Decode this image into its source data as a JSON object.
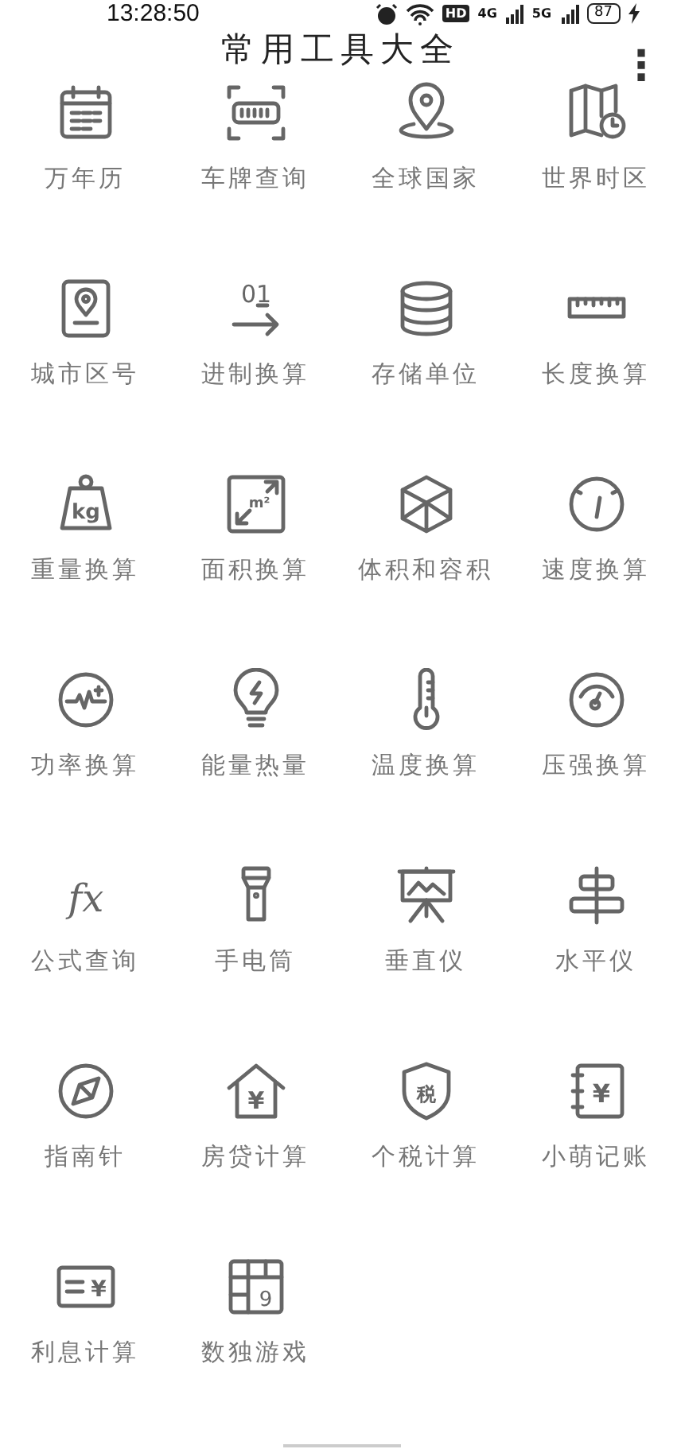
{
  "status_bar": {
    "time": "13:28:50",
    "hd": "HD",
    "net1": "4G",
    "net2": "5G",
    "battery": "87"
  },
  "header": {
    "title": "常用工具大全",
    "menu": "⋮"
  },
  "tools": [
    {
      "label": "万年历",
      "kind": "calendar"
    },
    {
      "label": "车牌查询",
      "kind": "plate"
    },
    {
      "label": "全球国家",
      "kind": "pin"
    },
    {
      "label": "世界时区",
      "kind": "mapclock"
    },
    {
      "label": "城市区号",
      "kind": "citypin"
    },
    {
      "label": "进制换算",
      "kind": "binary",
      "glyph": "01"
    },
    {
      "label": "存储单位",
      "kind": "database"
    },
    {
      "label": "长度换算",
      "kind": "ruler"
    },
    {
      "label": "重量换算",
      "kind": "weight",
      "glyph": "kg"
    },
    {
      "label": "面积换算",
      "kind": "area",
      "glyph": "m²"
    },
    {
      "label": "体积和容积",
      "kind": "cube"
    },
    {
      "label": "速度换算",
      "kind": "speed"
    },
    {
      "label": "功率换算",
      "kind": "power"
    },
    {
      "label": "能量热量",
      "kind": "bulb"
    },
    {
      "label": "温度换算",
      "kind": "thermo"
    },
    {
      "label": "压强换算",
      "kind": "gauge"
    },
    {
      "label": "公式查询",
      "kind": "formula",
      "glyph": "fx"
    },
    {
      "label": "手电筒",
      "kind": "torch"
    },
    {
      "label": "垂直仪",
      "kind": "easel"
    },
    {
      "label": "水平仪",
      "kind": "level"
    },
    {
      "label": "指南针",
      "kind": "compass"
    },
    {
      "label": "房贷计算",
      "kind": "house",
      "glyph": "¥"
    },
    {
      "label": "个税计算",
      "kind": "shield",
      "glyph": "税"
    },
    {
      "label": "小萌记账",
      "kind": "book",
      "glyph": "¥"
    },
    {
      "label": "利息计算",
      "kind": "card",
      "glyph": "¥"
    },
    {
      "label": "数独游戏",
      "kind": "sudoku",
      "glyph": "9"
    }
  ]
}
